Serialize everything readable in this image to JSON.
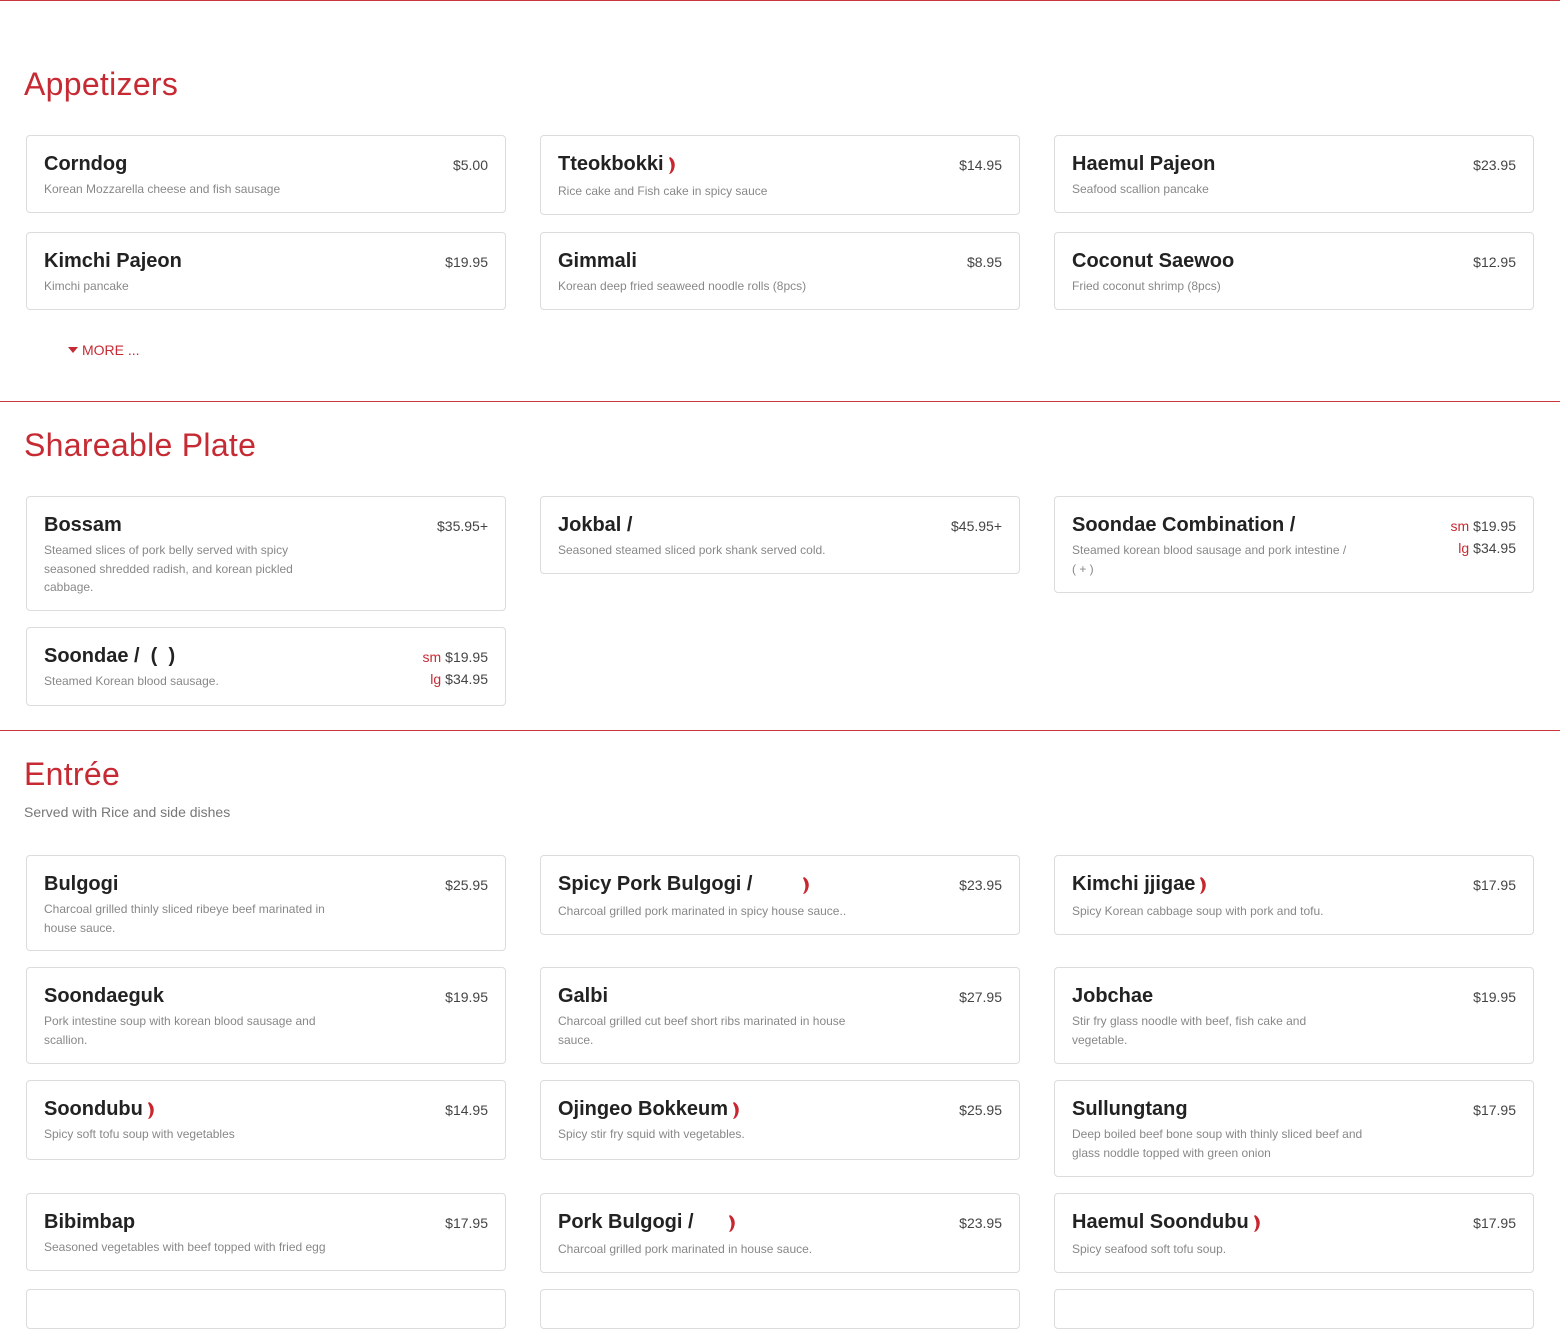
{
  "sections": {
    "appetizers": {
      "title": "Appetizers",
      "more_label": "MORE ...",
      "items": [
        {
          "name": "Corndog",
          "desc": "Korean Mozzarella cheese and fish sausage",
          "price": "$5.00",
          "spicy": false
        },
        {
          "name": "Tteokbokki",
          "desc": "Rice cake and Fish cake in spicy sauce",
          "price": "$14.95",
          "spicy": true
        },
        {
          "name": "Haemul Pajeon",
          "desc": "Seafood scallion pancake",
          "price": "$23.95",
          "spicy": false
        },
        {
          "name": "Kimchi Pajeon",
          "desc": "Kimchi pancake",
          "price": "$19.95",
          "spicy": false
        },
        {
          "name": "Gimmali",
          "desc": "Korean deep fried seaweed noodle rolls (8pcs)",
          "price": "$8.95",
          "spicy": false
        },
        {
          "name": "Coconut Saewoo",
          "desc": "Fried coconut shrimp (8pcs)",
          "price": "$12.95",
          "spicy": false
        }
      ]
    },
    "shareable": {
      "title": "Shareable Plate",
      "items": [
        {
          "name": "Bossam",
          "desc": "Steamed slices of pork belly served with spicy seasoned shredded radish, and korean pickled cabbage.",
          "price": "$35.95+"
        },
        {
          "name": "Jokbal /",
          "desc": "Seasoned steamed sliced pork shank served cold.",
          "price": "$45.95+"
        },
        {
          "name": "Soondae Combination /",
          "desc": "Steamed korean blood sausage and pork intestine / ( + )",
          "size_sm": "sm",
          "price_sm": "$19.95",
          "size_lg": "lg",
          "price_lg": "$34.95"
        },
        {
          "name": "Soondae /  (  )",
          "desc": "Steamed Korean blood sausage.",
          "size_sm": "sm",
          "price_sm": "$19.95",
          "size_lg": "lg",
          "price_lg": "$34.95"
        }
      ]
    },
    "entree": {
      "title": "Entrée",
      "subtitle": "Served with Rice and side dishes",
      "items": [
        {
          "name": "Bulgogi",
          "desc": "Charcoal grilled thinly sliced ribeye beef marinated in house sauce.",
          "price": "$25.95"
        },
        {
          "name": "Spicy Pork Bulgogi /",
          "desc": "Charcoal grilled pork marinated in spicy house sauce..",
          "price": "$23.95"
        },
        {
          "name": "Kimchi jjigae",
          "desc": "Spicy Korean cabbage soup with pork and tofu.",
          "price": "$17.95"
        },
        {
          "name": "Soondaeguk",
          "desc": "Pork intestine soup with korean blood sausage and scallion.",
          "price": "$19.95"
        },
        {
          "name": "Galbi",
          "desc": "Charcoal grilled cut beef short ribs marinated in house sauce.",
          "price": "$27.95"
        },
        {
          "name": "Jobchae",
          "desc": "Stir fry glass noodle with beef, fish cake and vegetable.",
          "price": "$19.95"
        },
        {
          "name": "Soondubu",
          "desc": "Spicy soft tofu soup with vegetables",
          "price": "$14.95"
        },
        {
          "name": "Ojingeo Bokkeum",
          "desc": "Spicy stir fry squid with vegetables.",
          "price": "$25.95"
        },
        {
          "name": "Sullungtang",
          "desc": "Deep boiled beef bone soup with thinly sliced beef and glass noddle topped with green onion",
          "price": "$17.95"
        },
        {
          "name": "Bibimbap",
          "desc": "Seasoned vegetables with beef topped with fried egg",
          "price": "$17.95"
        },
        {
          "name": "Pork Bulgogi /",
          "desc": "Charcoal grilled pork marinated in house sauce.",
          "price": "$23.95"
        },
        {
          "name": "Haemul Soondubu",
          "desc": "Spicy seafood soft tofu soup.",
          "price": "$17.95"
        }
      ]
    }
  },
  "colors": {
    "accent": "#c62b34",
    "divider": "#c9363d",
    "card_border": "#dcdcdc",
    "desc_text": "#888888"
  },
  "icons": {
    "spicy": "chili-pepper-icon",
    "more": "caret-down-icon"
  }
}
